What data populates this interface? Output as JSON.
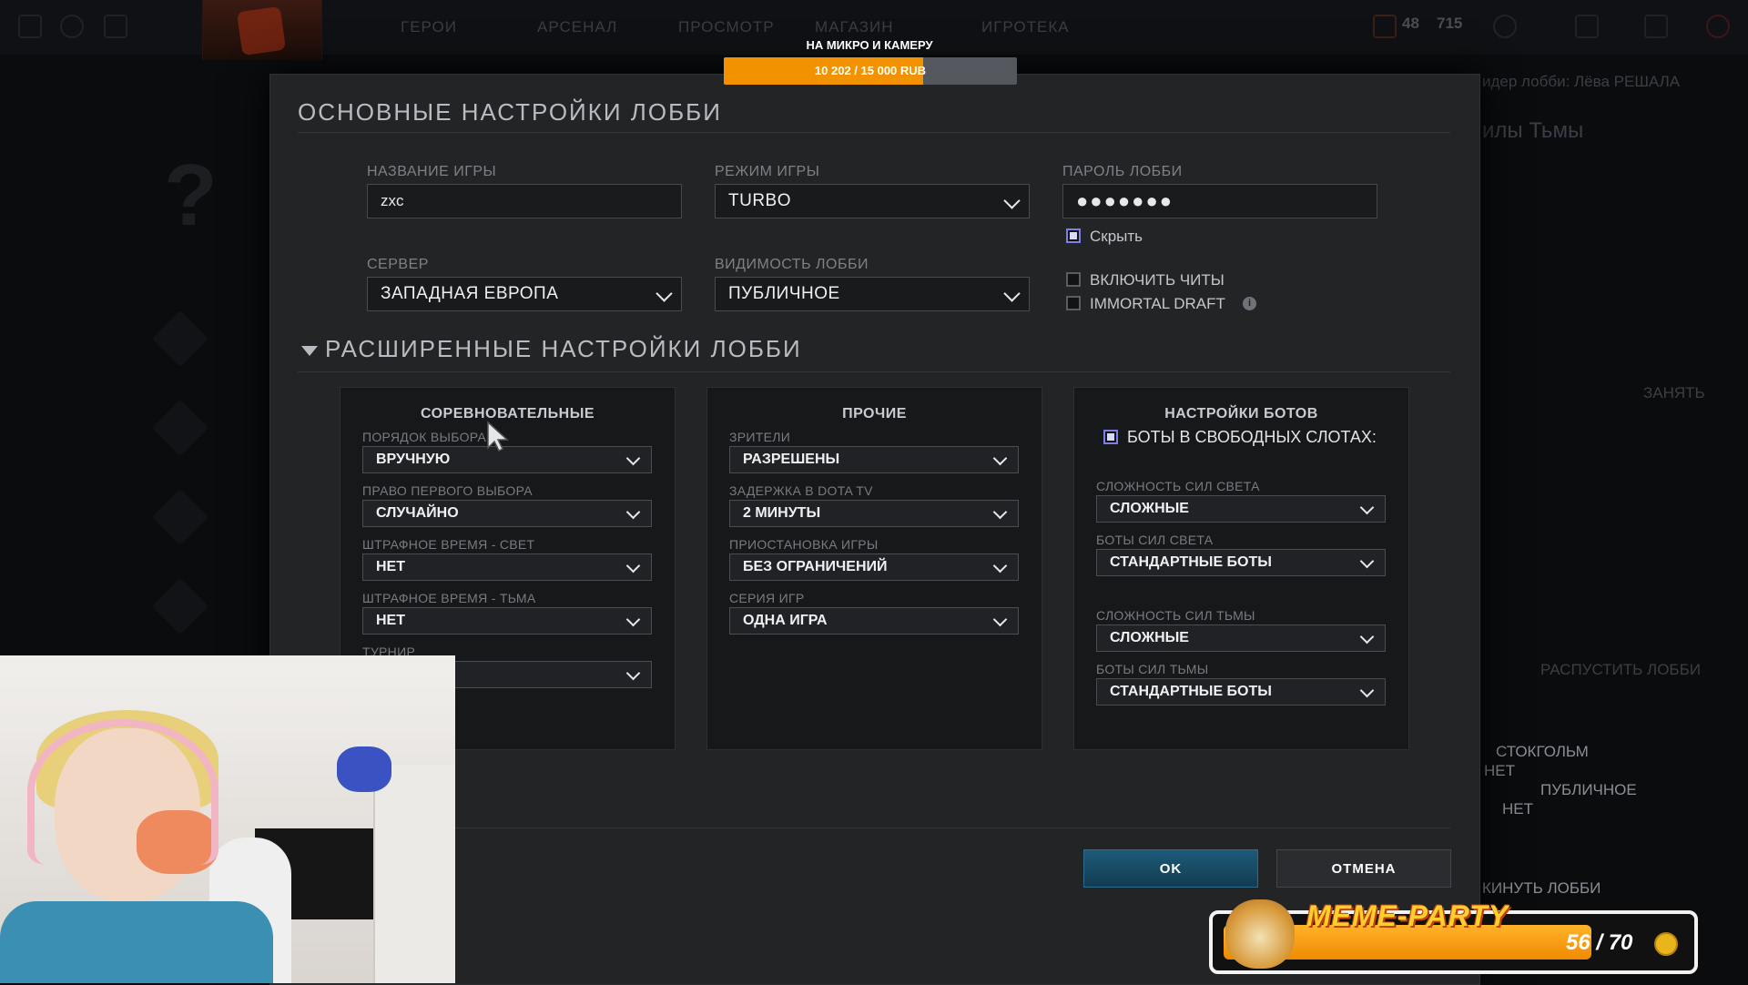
{
  "background": {
    "nav_items": [
      "ГЕРОИ",
      "АРСЕНАЛ",
      "ПРОСМОТР",
      "МАГАЗИН",
      "ИГРОТЕКА"
    ],
    "top_stats": [
      "48",
      "715"
    ],
    "right_texts": {
      "lobby_leader": "идер лобби: Лёва РЕШАЛА",
      "dire": "илы Тьмы",
      "join": "ЗАНЯТЬ",
      "disband": "РАСПУСТИТЬ ЛОББИ",
      "server_value": "СТОКГОЛЬМ",
      "value_no_1": "НЕТ",
      "visibility_value": "ПУБЛИЧНОЕ",
      "value_no_2": "НЕТ",
      "leave_lobby": "КИНУТЬ ЛОББИ"
    }
  },
  "donation": {
    "title": "НА МИКРО И КАМЕРУ",
    "progress_text": "10 202 / 15 000 RUB",
    "fraction": 0.68
  },
  "modal": {
    "title": "ОСНОВНЫЕ НАСТРОЙКИ ЛОББИ",
    "game_name_label": "НАЗВАНИЕ ИГРЫ",
    "game_name_value": "zxc",
    "game_mode_label": "РЕЖИМ ИГРЫ",
    "game_mode_value": "TURBO",
    "password_label": "ПАРОЛЬ ЛОББИ",
    "password_value": "●●●●●●●",
    "hide_label": "Скрыть",
    "hide_checked": true,
    "server_label": "СЕРВЕР",
    "server_value": "ЗАПАДНАЯ ЕВРОПА",
    "visibility_label": "ВИДИМОСТЬ ЛОББИ",
    "visibility_value": "ПУБЛИЧНОЕ",
    "cheats_label": "ВКЛЮЧИТЬ ЧИТЫ",
    "cheats_checked": false,
    "immortal_label": "IMMORTAL DRAFT",
    "immortal_checked": false,
    "advanced_title": "РАСШИРЕННЫЕ НАСТРОЙКИ ЛОББИ",
    "competitive": {
      "title": "СОРЕВНОВАТЕЛЬНЫЕ",
      "fields": [
        {
          "label": "ПОРЯДОК ВЫБОРА",
          "value": "ВРУЧНУЮ"
        },
        {
          "label": "ПРАВО ПЕРВОГО ВЫБОРА",
          "value": "СЛУЧАЙНО"
        },
        {
          "label": "ШТРАФНОЕ ВРЕМЯ - СВЕТ",
          "value": "НЕТ"
        },
        {
          "label": "ШТРАФНОЕ ВРЕМЯ - ТЬМА",
          "value": "НЕТ"
        },
        {
          "label": "ТУРНИР",
          "value": ""
        }
      ]
    },
    "other": {
      "title": "ПРОЧИЕ",
      "fields": [
        {
          "label": "ЗРИТЕЛИ",
          "value": "РАЗРЕШЕНЫ"
        },
        {
          "label": "ЗАДЕРЖКА В DOTA TV",
          "value": "2 МИНУТЫ"
        },
        {
          "label": "ПРИОСТАНОВКА ИГРЫ",
          "value": "БЕЗ ОГРАНИЧЕНИЙ"
        },
        {
          "label": "СЕРИЯ ИГР",
          "value": "ОДНА ИГРА"
        }
      ]
    },
    "bots": {
      "title": "НАСТРОЙКИ БОТОВ",
      "fill_label": "БОТЫ В СВОБОДНЫХ СЛОТАХ:",
      "fill_checked": true,
      "fields": [
        {
          "label": "СЛОЖНОСТЬ СИЛ СВЕТА",
          "value": "СЛОЖНЫЕ"
        },
        {
          "label": "БОТЫ СИЛ СВЕТА",
          "value": "СТАНДАРТНЫЕ БОТЫ"
        },
        {
          "label": "СЛОЖНОСТЬ СИЛ ТЬМЫ",
          "value": "СЛОЖНЫЕ"
        },
        {
          "label": "БОТЫ СИЛ ТЬМЫ",
          "value": "СТАНДАРТНЫЕ БОТЫ"
        }
      ]
    },
    "ok_label": "OK",
    "cancel_label": "ОТМЕНА"
  },
  "meme_party": {
    "title": "MEME-PARTY",
    "count_text": "56 / 70",
    "fraction": 0.8
  }
}
